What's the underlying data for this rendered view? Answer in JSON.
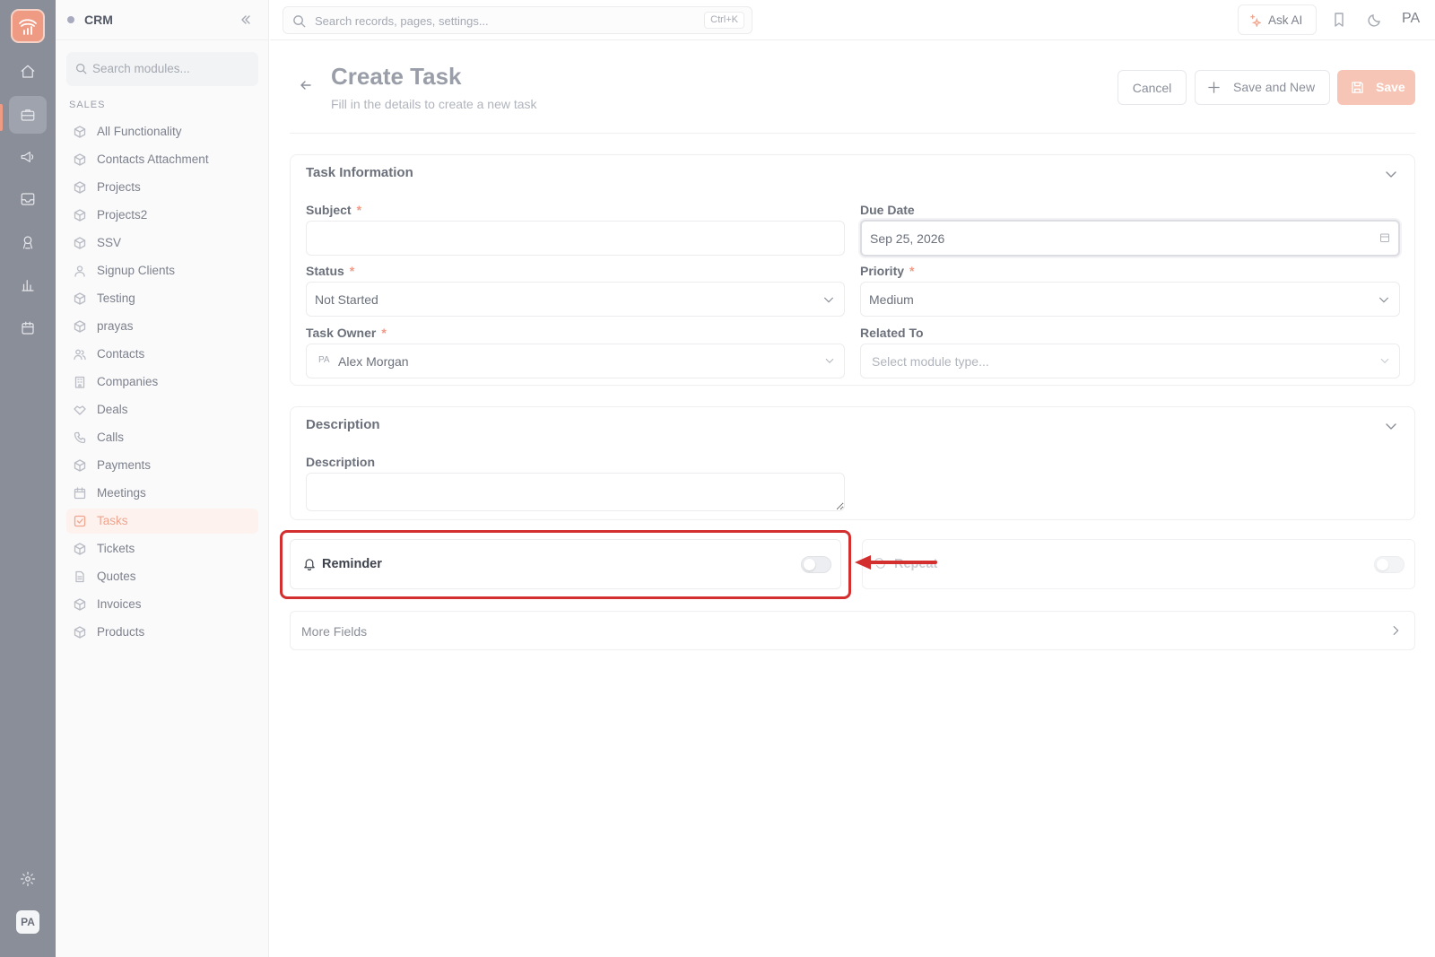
{
  "app": {
    "name": "CRM"
  },
  "sidebar": {
    "search_placeholder": "Search modules...",
    "section": "SALES",
    "items": [
      {
        "label": "All Functionality",
        "icon": "cube-icon"
      },
      {
        "label": "Contacts Attachment",
        "icon": "cube-icon"
      },
      {
        "label": "Projects",
        "icon": "cube-icon"
      },
      {
        "label": "Projects2",
        "icon": "cube-icon"
      },
      {
        "label": "SSV",
        "icon": "cube-icon"
      },
      {
        "label": "Signup Clients",
        "icon": "user-icon"
      },
      {
        "label": "Testing",
        "icon": "cube-icon"
      },
      {
        "label": "prayas",
        "icon": "cube-icon"
      },
      {
        "label": "Contacts",
        "icon": "users-icon"
      },
      {
        "label": "Companies",
        "icon": "building-icon"
      },
      {
        "label": "Deals",
        "icon": "handshake-icon"
      },
      {
        "label": "Calls",
        "icon": "phone-icon"
      },
      {
        "label": "Payments",
        "icon": "cube-icon"
      },
      {
        "label": "Meetings",
        "icon": "calendar-icon"
      },
      {
        "label": "Tasks",
        "icon": "task-check-icon",
        "active": true
      },
      {
        "label": "Tickets",
        "icon": "cube-icon"
      },
      {
        "label": "Quotes",
        "icon": "document-icon"
      },
      {
        "label": "Invoices",
        "icon": "cube-icon"
      },
      {
        "label": "Products",
        "icon": "cube-icon"
      }
    ]
  },
  "topbar": {
    "search_placeholder": "Search records, pages, settings...",
    "shortcut": "Ctrl+K",
    "ask_ai": "Ask AI",
    "user_initials": "PA"
  },
  "rail": {
    "user_initials": "PA"
  },
  "page": {
    "title": "Create Task",
    "subtitle": "Fill in the details to create a new task",
    "cancel": "Cancel",
    "save_and_new": "Save and New",
    "save": "Save"
  },
  "task_info": {
    "title": "Task Information",
    "subject_label": "Subject",
    "subject_value": "",
    "due_date_label": "Due Date",
    "due_date_value": "Sep 25, 2026",
    "status_label": "Status",
    "status_value": "Not Started",
    "priority_label": "Priority",
    "priority_value": "Medium",
    "owner_label": "Task Owner",
    "owner_initials": "PA",
    "owner_value": "Alex Morgan",
    "related_label": "Related To",
    "related_placeholder": "Select module type...",
    "required_mark": "*"
  },
  "description": {
    "title": "Description",
    "field_label": "Description",
    "value": ""
  },
  "reminder": {
    "label": "Reminder",
    "enabled": false
  },
  "repeat": {
    "label": "Repeat",
    "enabled": false
  },
  "more_fields": {
    "label": "More Fields"
  },
  "colors": {
    "accent": "#ef9a83",
    "highlight": "#d32f2f"
  }
}
